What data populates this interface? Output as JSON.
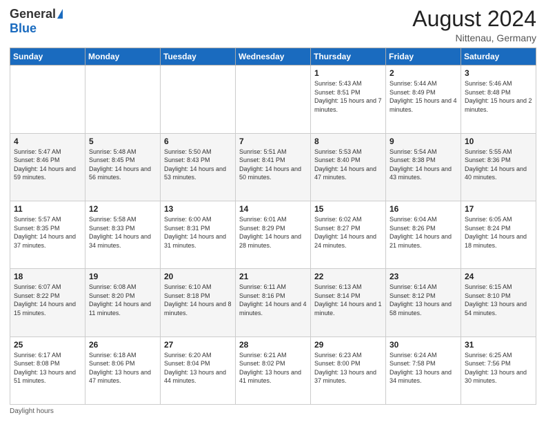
{
  "header": {
    "logo_general": "General",
    "logo_blue": "Blue",
    "month_year": "August 2024",
    "location": "Nittenau, Germany"
  },
  "days_of_week": [
    "Sunday",
    "Monday",
    "Tuesday",
    "Wednesday",
    "Thursday",
    "Friday",
    "Saturday"
  ],
  "footer": "Daylight hours",
  "weeks": [
    [
      {
        "day": "",
        "info": ""
      },
      {
        "day": "",
        "info": ""
      },
      {
        "day": "",
        "info": ""
      },
      {
        "day": "",
        "info": ""
      },
      {
        "day": "1",
        "info": "Sunrise: 5:43 AM\nSunset: 8:51 PM\nDaylight: 15 hours\nand 7 minutes."
      },
      {
        "day": "2",
        "info": "Sunrise: 5:44 AM\nSunset: 8:49 PM\nDaylight: 15 hours\nand 4 minutes."
      },
      {
        "day": "3",
        "info": "Sunrise: 5:46 AM\nSunset: 8:48 PM\nDaylight: 15 hours\nand 2 minutes."
      }
    ],
    [
      {
        "day": "4",
        "info": "Sunrise: 5:47 AM\nSunset: 8:46 PM\nDaylight: 14 hours\nand 59 minutes."
      },
      {
        "day": "5",
        "info": "Sunrise: 5:48 AM\nSunset: 8:45 PM\nDaylight: 14 hours\nand 56 minutes."
      },
      {
        "day": "6",
        "info": "Sunrise: 5:50 AM\nSunset: 8:43 PM\nDaylight: 14 hours\nand 53 minutes."
      },
      {
        "day": "7",
        "info": "Sunrise: 5:51 AM\nSunset: 8:41 PM\nDaylight: 14 hours\nand 50 minutes."
      },
      {
        "day": "8",
        "info": "Sunrise: 5:53 AM\nSunset: 8:40 PM\nDaylight: 14 hours\nand 47 minutes."
      },
      {
        "day": "9",
        "info": "Sunrise: 5:54 AM\nSunset: 8:38 PM\nDaylight: 14 hours\nand 43 minutes."
      },
      {
        "day": "10",
        "info": "Sunrise: 5:55 AM\nSunset: 8:36 PM\nDaylight: 14 hours\nand 40 minutes."
      }
    ],
    [
      {
        "day": "11",
        "info": "Sunrise: 5:57 AM\nSunset: 8:35 PM\nDaylight: 14 hours\nand 37 minutes."
      },
      {
        "day": "12",
        "info": "Sunrise: 5:58 AM\nSunset: 8:33 PM\nDaylight: 14 hours\nand 34 minutes."
      },
      {
        "day": "13",
        "info": "Sunrise: 6:00 AM\nSunset: 8:31 PM\nDaylight: 14 hours\nand 31 minutes."
      },
      {
        "day": "14",
        "info": "Sunrise: 6:01 AM\nSunset: 8:29 PM\nDaylight: 14 hours\nand 28 minutes."
      },
      {
        "day": "15",
        "info": "Sunrise: 6:02 AM\nSunset: 8:27 PM\nDaylight: 14 hours\nand 24 minutes."
      },
      {
        "day": "16",
        "info": "Sunrise: 6:04 AM\nSunset: 8:26 PM\nDaylight: 14 hours\nand 21 minutes."
      },
      {
        "day": "17",
        "info": "Sunrise: 6:05 AM\nSunset: 8:24 PM\nDaylight: 14 hours\nand 18 minutes."
      }
    ],
    [
      {
        "day": "18",
        "info": "Sunrise: 6:07 AM\nSunset: 8:22 PM\nDaylight: 14 hours\nand 15 minutes."
      },
      {
        "day": "19",
        "info": "Sunrise: 6:08 AM\nSunset: 8:20 PM\nDaylight: 14 hours\nand 11 minutes."
      },
      {
        "day": "20",
        "info": "Sunrise: 6:10 AM\nSunset: 8:18 PM\nDaylight: 14 hours\nand 8 minutes."
      },
      {
        "day": "21",
        "info": "Sunrise: 6:11 AM\nSunset: 8:16 PM\nDaylight: 14 hours\nand 4 minutes."
      },
      {
        "day": "22",
        "info": "Sunrise: 6:13 AM\nSunset: 8:14 PM\nDaylight: 14 hours\nand 1 minute."
      },
      {
        "day": "23",
        "info": "Sunrise: 6:14 AM\nSunset: 8:12 PM\nDaylight: 13 hours\nand 58 minutes."
      },
      {
        "day": "24",
        "info": "Sunrise: 6:15 AM\nSunset: 8:10 PM\nDaylight: 13 hours\nand 54 minutes."
      }
    ],
    [
      {
        "day": "25",
        "info": "Sunrise: 6:17 AM\nSunset: 8:08 PM\nDaylight: 13 hours\nand 51 minutes."
      },
      {
        "day": "26",
        "info": "Sunrise: 6:18 AM\nSunset: 8:06 PM\nDaylight: 13 hours\nand 47 minutes."
      },
      {
        "day": "27",
        "info": "Sunrise: 6:20 AM\nSunset: 8:04 PM\nDaylight: 13 hours\nand 44 minutes."
      },
      {
        "day": "28",
        "info": "Sunrise: 6:21 AM\nSunset: 8:02 PM\nDaylight: 13 hours\nand 41 minutes."
      },
      {
        "day": "29",
        "info": "Sunrise: 6:23 AM\nSunset: 8:00 PM\nDaylight: 13 hours\nand 37 minutes."
      },
      {
        "day": "30",
        "info": "Sunrise: 6:24 AM\nSunset: 7:58 PM\nDaylight: 13 hours\nand 34 minutes."
      },
      {
        "day": "31",
        "info": "Sunrise: 6:25 AM\nSunset: 7:56 PM\nDaylight: 13 hours\nand 30 minutes."
      }
    ]
  ]
}
